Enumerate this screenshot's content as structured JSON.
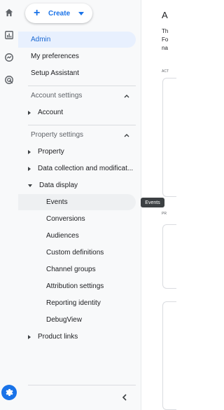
{
  "rail": {
    "icons": [
      "home-icon",
      "reports-icon",
      "explore-icon",
      "advertising-icon"
    ],
    "settings_icon": "gear-icon"
  },
  "create": {
    "label": "Create"
  },
  "nav": {
    "admin": "Admin",
    "preferences": "My preferences",
    "setup": "Setup Assistant",
    "account_settings": "Account settings",
    "account": "Account",
    "property_settings": "Property settings",
    "property": "Property",
    "data_collection": "Data collection and modificat...",
    "data_display": "Data display",
    "data_display_items": [
      "Events",
      "Conversions",
      "Audiences",
      "Custom definitions",
      "Channel groups",
      "Attribution settings",
      "Reporting identity",
      "DebugView"
    ],
    "product_links": "Product links"
  },
  "tooltip": "Events",
  "main_fragments": {
    "heading": "A",
    "line1": "Th",
    "line2": "Fo",
    "line3": "na",
    "label_a": "ACT",
    "label_b": "PR"
  },
  "colors": {
    "accent": "#1a73e8",
    "active_bg": "#e8f0fe"
  }
}
